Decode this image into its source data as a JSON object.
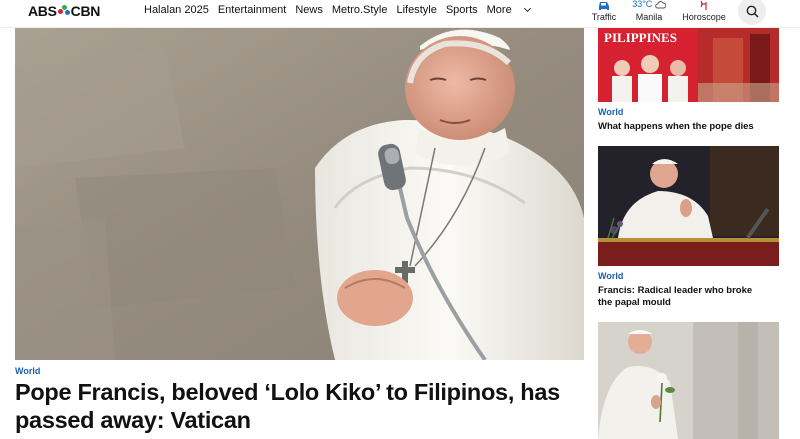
{
  "brand": {
    "logo_text_left": "ABS",
    "logo_text_right": "CBN"
  },
  "nav": {
    "items": [
      "Halalan 2025",
      "Entertainment",
      "News",
      "Metro.Style",
      "Lifestyle",
      "Sports"
    ],
    "more_label": "More"
  },
  "utilities": {
    "traffic_label": "Traffic",
    "weather_temp": "33°C",
    "weather_city": "Manila",
    "horoscope_label": "Horoscope"
  },
  "hero": {
    "section": "World",
    "headline": "Pope Francis, beloved ‘Lolo Kiko’ to Filipinos, has passed away: Vatican"
  },
  "sidebar": {
    "cards": [
      {
        "image_text": "PILIPPINES",
        "section": "World",
        "title": "What happens when the pope dies"
      },
      {
        "section": "World",
        "title": "Francis: Radical leader who broke the papal mould"
      },
      {
        "section": "",
        "title": ""
      }
    ]
  },
  "colors": {
    "accent": "#1c5fb5",
    "logo_red": "#d6232a",
    "logo_green": "#3aa655",
    "logo_blue": "#1f6fc9"
  }
}
